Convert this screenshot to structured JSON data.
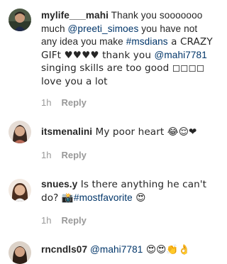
{
  "comments": [
    {
      "username": "mylife___mahi",
      "parts": [
        {
          "t": " Thank you sooooooo much ",
          "link": false
        },
        {
          "t": "@preeti_simoes",
          "link": true
        },
        {
          "t": " you have not any idea you make ",
          "link": false
        },
        {
          "t": "#msdians",
          "link": true
        },
        {
          "t": " a CRAZY GIFt ♥♥♥♥ thank you ",
          "link": false
        },
        {
          "t": "@mahi7781",
          "link": true
        },
        {
          "t": " singing skills are too good ◻◻◻◻ love you a lot",
          "link": false
        }
      ],
      "time": "1h",
      "reply_label": "Reply"
    },
    {
      "username": "itsmenalini",
      "parts": [
        {
          "t": " My poor heart 😂😌❤",
          "link": false
        }
      ],
      "time": "1h",
      "reply_label": "Reply"
    },
    {
      "username": "snues.y",
      "parts": [
        {
          "t": " Is there anything he can't do? 📸",
          "link": false
        },
        {
          "t": "#mostfavorite",
          "link": true
        },
        {
          "t": " 😍",
          "link": false
        }
      ],
      "time": "1h",
      "reply_label": "Reply"
    },
    {
      "username": "rncndls07",
      "parts": [
        {
          "t": " ",
          "link": false
        },
        {
          "t": "@mahi7781",
          "link": true
        },
        {
          "t": " 😍😍👏👌",
          "link": false
        }
      ],
      "time": "",
      "reply_label": ""
    }
  ]
}
